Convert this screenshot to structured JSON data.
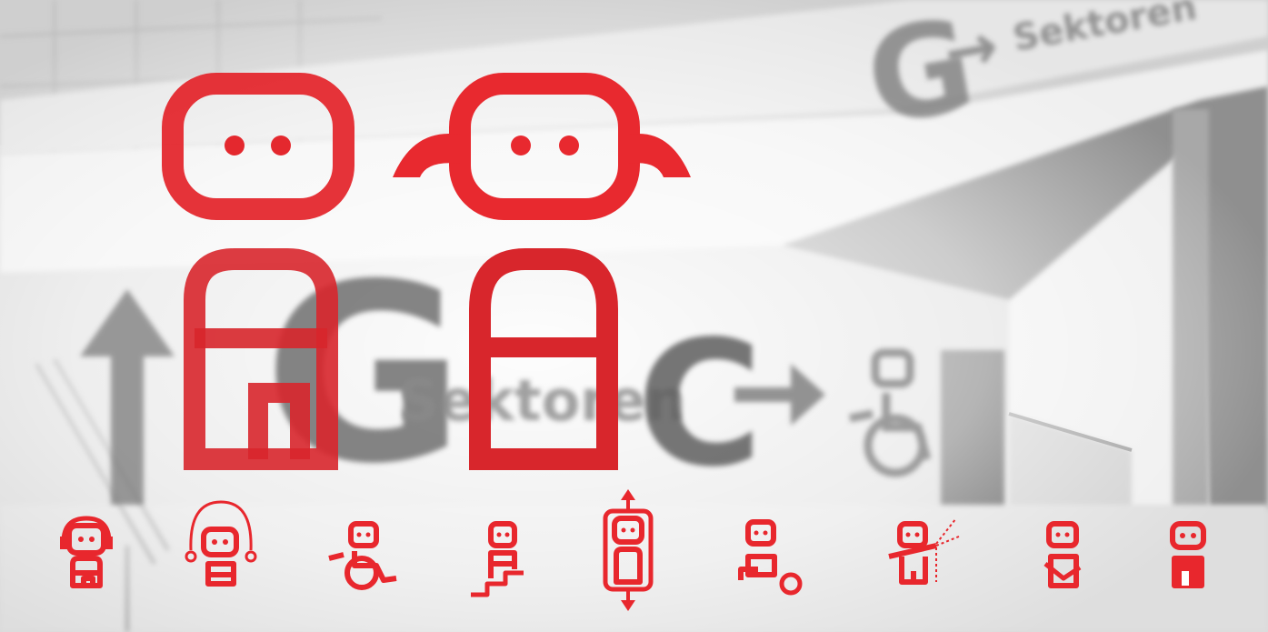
{
  "background": {
    "sign_word": "Sektoren",
    "sign_letter_small": "G",
    "sign_letter_large": "C",
    "sign_arrow": "→",
    "sign_letter_overlay": "G",
    "sign_arrow_up": "↑",
    "photo_tone": "#c8c8c8"
  },
  "colors": {
    "accent": "#e8272d",
    "overlay_white": "#ffffff",
    "sign_gray": "#7a7a7a"
  },
  "figures": {
    "large": [
      "boy-figure-icon",
      "girl-figure-icon"
    ],
    "small": [
      "headphones-figure-icon",
      "wheelchair-accessible-figure-icon",
      "wheelchair-figure-icon",
      "stairs-figure-icon",
      "elevator-figure-icon",
      "ball-figure-icon",
      "shower-figure-icon",
      "baby-care-figure-icon",
      "standing-figure-icon"
    ]
  }
}
